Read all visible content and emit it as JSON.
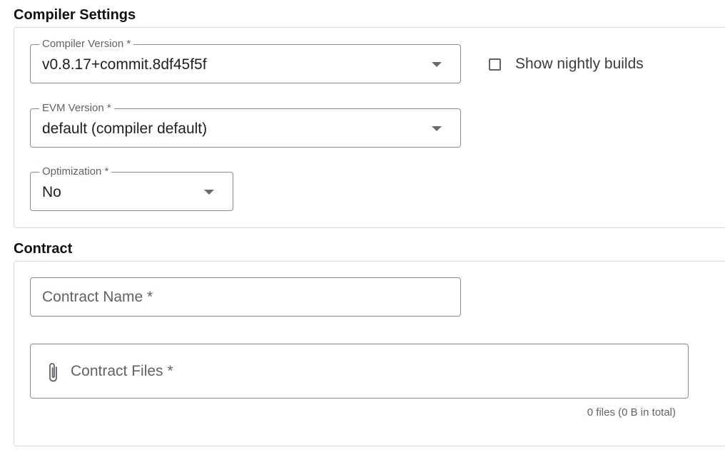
{
  "compiler_settings": {
    "title": "Compiler Settings",
    "compiler_version": {
      "label": "Compiler Version *",
      "value": "v0.8.17+commit.8df45f5f"
    },
    "nightly_builds": {
      "label": "Show nightly builds",
      "checked": false
    },
    "evm_version": {
      "label": "EVM Version *",
      "value": "default (compiler default)"
    },
    "optimization": {
      "label": "Optimization *",
      "value": "No"
    }
  },
  "contract": {
    "title": "Contract",
    "name_placeholder": "Contract Name *",
    "files_placeholder": "Contract Files *",
    "files_icon": "paperclip-icon",
    "files_summary": "0 files (0 B in total)"
  },
  "colors": {
    "border": "#8a8a8a",
    "panel_border": "#d9d9d9",
    "label": "#5f6368",
    "text": "#1f1f1f"
  }
}
